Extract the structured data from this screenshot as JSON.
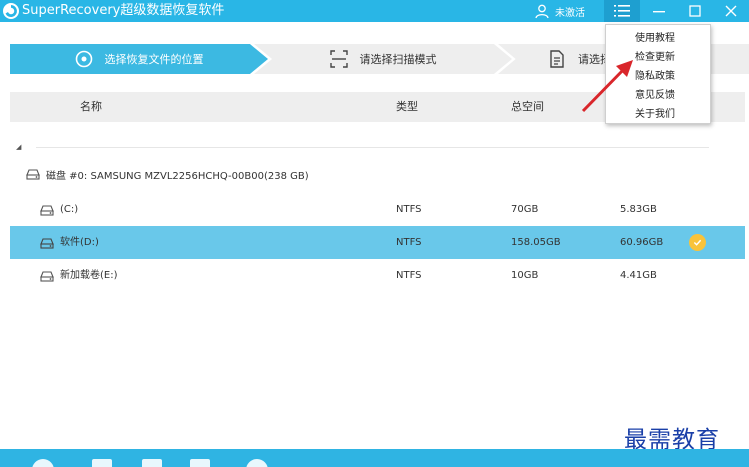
{
  "titlebar": {
    "app_title": "SuperRecovery超级数据恢复软件",
    "user_label": "未激活",
    "icons": [
      "app-logo",
      "user-icon",
      "menu-icon",
      "minimize-icon",
      "maximize-icon",
      "close-icon"
    ]
  },
  "steps": [
    {
      "label": "选择恢复文件的位置",
      "icon": "target-icon",
      "active": true
    },
    {
      "label": "请选择扫描模式",
      "icon": "scan-icon",
      "active": false
    },
    {
      "label": "请选择",
      "icon": "document-icon",
      "active": false
    }
  ],
  "table": {
    "headers": {
      "name": "名称",
      "type": "类型",
      "total": "总空间"
    }
  },
  "disk": {
    "label": "磁盘 #0: SAMSUNG MZVL2256HCHQ-00B00(238 GB)"
  },
  "partitions": [
    {
      "name": "(C:)",
      "type": "NTFS",
      "total": "70GB",
      "free": "5.83GB",
      "selected": false
    },
    {
      "name": "软件(D:)",
      "type": "NTFS",
      "total": "158.05GB",
      "free": "60.96GB",
      "selected": true
    },
    {
      "name": "新加载卷(E:)",
      "type": "NTFS",
      "total": "10GB",
      "free": "4.41GB",
      "selected": false
    }
  ],
  "menu": {
    "items": [
      "使用教程",
      "检查更新",
      "隐私政策",
      "意见反馈",
      "关于我们"
    ]
  },
  "watermark": "最需教育",
  "colors": {
    "accent": "#29b6e6",
    "selected_row": "#69c8ea",
    "check": "#f8c33a",
    "arrow": "#d9262b"
  }
}
